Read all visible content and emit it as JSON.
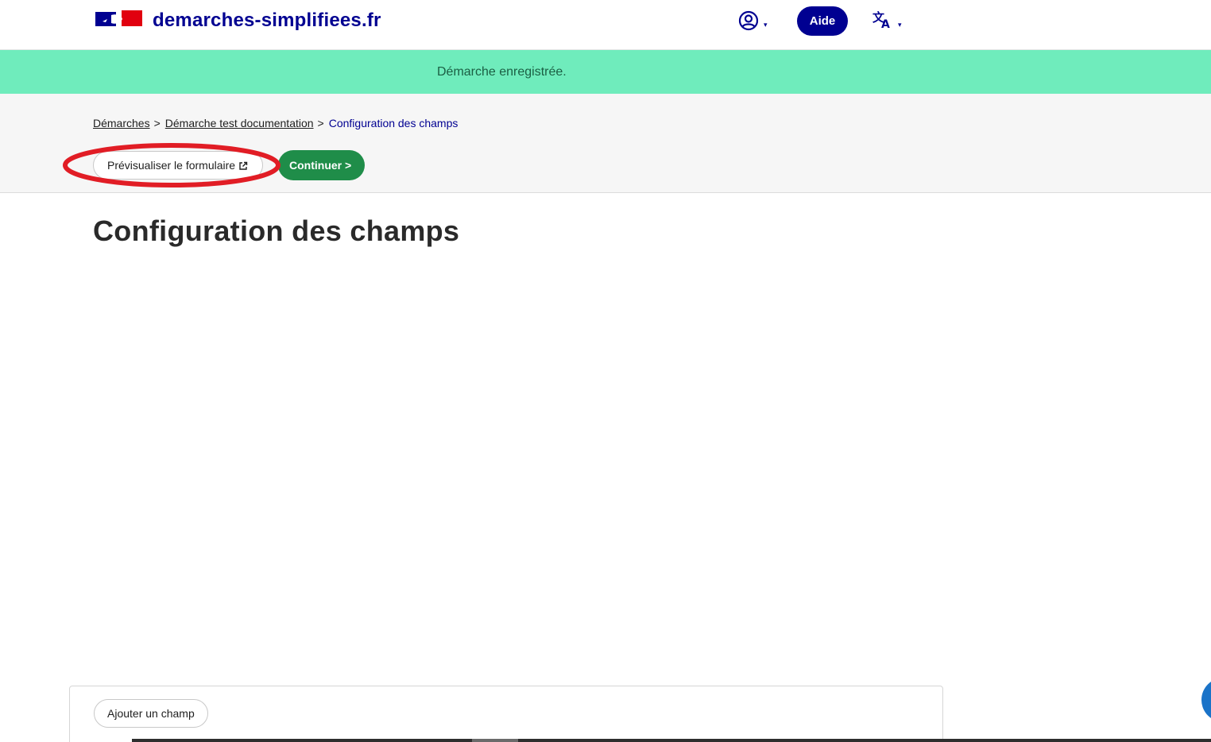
{
  "header": {
    "brand": "demarches-simplifiees.fr",
    "logo_icon": "marianne-flag-icon",
    "user_icon": "user-circle-icon",
    "help_label": "Aide",
    "language_icon": "translate-icon",
    "caret": "▾"
  },
  "flash": {
    "message": "Démarche enregistrée."
  },
  "breadcrumb": {
    "items": [
      "Démarches",
      "Démarche test documentation",
      "Configuration des champs"
    ],
    "separator": ">"
  },
  "actions": {
    "preview_label": "Prévisualiser le formulaire",
    "continue_label": "Continuer >"
  },
  "main": {
    "title": "Configuration des champs",
    "add_field_label": "Ajouter un champ"
  },
  "colors": {
    "brand_blue": "#000091",
    "flash_green": "#6fecbc",
    "continue_green": "#1f8d49",
    "highlight_red": "#e11d25"
  }
}
